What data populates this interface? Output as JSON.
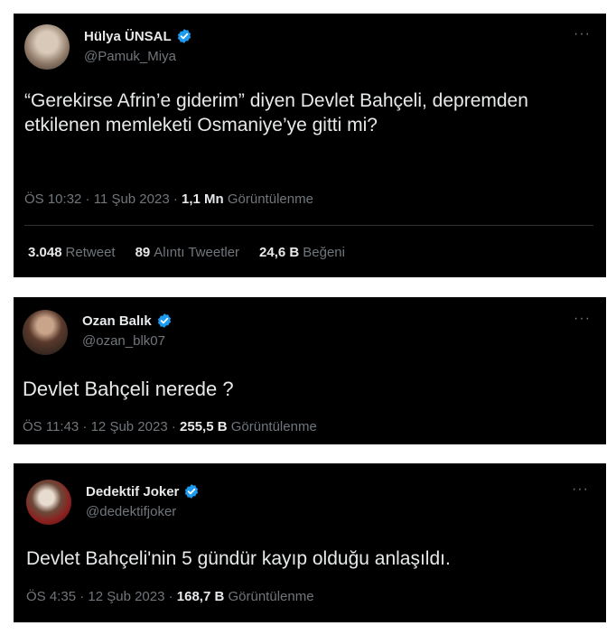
{
  "tweets": [
    {
      "name": "Hülya ÜNSAL",
      "handle": "@Pamuk_Miya",
      "more": "···",
      "text": "“Gerekirse Afrin’e giderim” diyen Devlet Bahçeli, depremden etkilenen memleketi Osmaniye’ye gitti mi?",
      "time": "ÖS 10:32 · 11 Şub 2023 · ",
      "views": "1,1 Mn",
      "views_label": " Görüntülenme",
      "retweets": "3.048",
      "retweets_label": "Retweet",
      "quotes": "89",
      "quotes_label": "Alıntı Tweetler",
      "likes": "24,6 B",
      "likes_label": "Beğeni"
    },
    {
      "name": "Ozan Balık",
      "handle": "@ozan_blk07",
      "more": "···",
      "text": "Devlet Bahçeli nerede ?",
      "time": "ÖS 11:43 · 12 Şub 2023 · ",
      "views": "255,5 B",
      "views_label": " Görüntülenme"
    },
    {
      "name": "Dedektif Joker",
      "handle": "@dedektifjoker",
      "more": "···",
      "text": "Devlet Bahçeli'nin 5 gündür kayıp olduğu anlaşıldı.",
      "time": "ÖS 4:35 · 12 Şub 2023 · ",
      "views": "168,7 B",
      "views_label": " Görüntülenme"
    }
  ],
  "colors": {
    "background": "#000000",
    "text": "#e7e9ea",
    "muted": "#71767b",
    "verified": "#1d9bf0"
  }
}
